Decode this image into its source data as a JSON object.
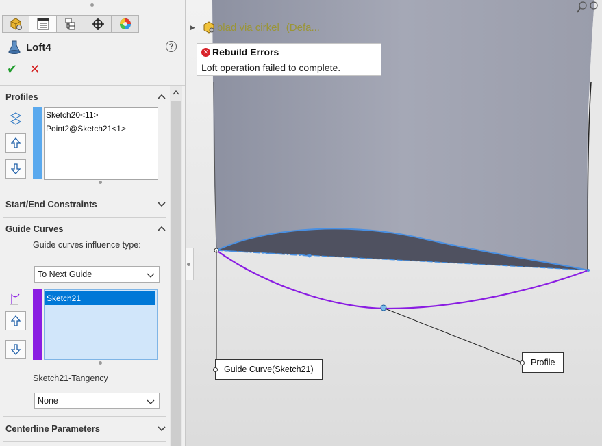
{
  "feature": {
    "title": "Loft4",
    "help": "?",
    "ok": "✔",
    "cancel": "✕"
  },
  "tabs": [
    {
      "name": "feature-manager-tab-icon",
      "active": false
    },
    {
      "name": "property-manager-tab-icon",
      "active": true
    },
    {
      "name": "configuration-manager-tab-icon",
      "active": false
    },
    {
      "name": "dimxpert-manager-tab-icon",
      "active": false
    },
    {
      "name": "display-manager-tab-icon",
      "active": false
    }
  ],
  "profiles": {
    "title": "Profiles",
    "items": [
      "Sketch20<11>",
      "Point2@Sketch21<1>"
    ],
    "color": "#5aa9ee"
  },
  "start_end": {
    "title": "Start/End Constraints"
  },
  "guide_curves": {
    "title": "Guide Curves",
    "influence_label": "Guide curves influence type:",
    "influence_value": "To Next Guide",
    "items": [
      "Sketch21"
    ],
    "color": "#8a1de2",
    "tangency_label": "Sketch21-Tangency",
    "tangency_value": "None"
  },
  "centerline": {
    "title": "Centerline Parameters"
  },
  "tree": {
    "part_name": "blad via cirkel",
    "config": "(Defa..."
  },
  "error_tooltip": {
    "title": "Rebuild Errors",
    "message": "Loft operation failed to complete."
  },
  "callouts": {
    "guide": "Guide Curve(Sketch21)",
    "profile": "Profile"
  },
  "colors": {
    "selection_blue": "#0078d7",
    "guide_purple": "#8a1de2",
    "profile_blue": "#4a90e2",
    "body_gray": "#9a9daa",
    "error_red": "#d8232a"
  }
}
